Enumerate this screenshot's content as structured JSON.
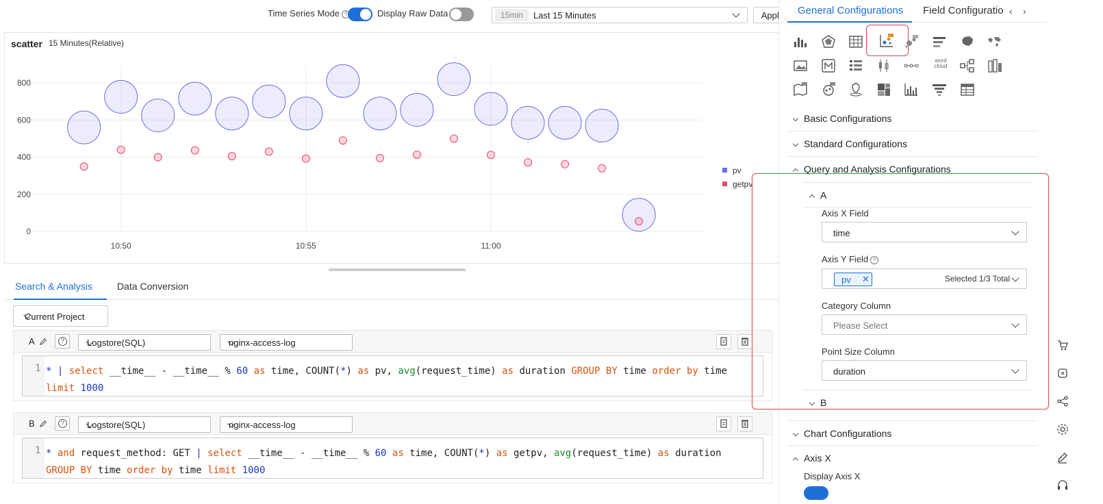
{
  "toolbar": {
    "time_series_mode_label": "Time Series Mode",
    "display_raw_data_label": "Display Raw Data",
    "time_range_tag": "15min",
    "time_range_value": "Last 15 Minutes",
    "apply_label": "Apply",
    "time_series_mode_on": true,
    "display_raw_data_on": false
  },
  "chart_panel": {
    "title": "scatter",
    "subtitle": "15 Minutes(Relative)"
  },
  "chart_data": {
    "type": "scatter",
    "title": "scatter",
    "x_tick_labels": [
      "10:50",
      "10:55",
      "11:00"
    ],
    "y_tick_labels": [
      "0",
      "200",
      "400",
      "600",
      "800"
    ],
    "ylim": [
      0,
      800
    ],
    "legend_position": "right",
    "grid": true,
    "series": [
      {
        "name": "pv",
        "color": "#6b6be8",
        "x": [
          "10:49",
          "10:50",
          "10:51",
          "10:52",
          "10:53",
          "10:54",
          "10:55",
          "10:56",
          "10:57",
          "10:58",
          "10:59",
          "11:00",
          "11:01",
          "11:02",
          "11:03",
          "11:04"
        ],
        "values": [
          560,
          725,
          625,
          715,
          635,
          700,
          635,
          810,
          635,
          655,
          820,
          660,
          585,
          585,
          570,
          90
        ]
      },
      {
        "name": "getpv",
        "color": "#e84a6e",
        "x": [
          "10:49",
          "10:50",
          "10:51",
          "10:52",
          "10:53",
          "10:54",
          "10:55",
          "10:56",
          "10:57",
          "10:58",
          "10:59",
          "11:00",
          "11:01",
          "11:02",
          "11:03",
          "11:04"
        ],
        "values": [
          350,
          440,
          400,
          437,
          405,
          430,
          392,
          490,
          395,
          413,
          500,
          412,
          372,
          362,
          340,
          55
        ]
      }
    ]
  },
  "bottom_tabs": [
    "Search & Analysis",
    "Data Conversion"
  ],
  "project_select": "Current Project",
  "queries": [
    {
      "letter": "A",
      "store_type": "Logstore(SQL)",
      "logstore": "nginx-access-log",
      "line_number": "1",
      "code": "* | select __time__ - __time__ % 60 as time, COUNT(*) as pv, avg(request_time) as duration GROUP BY time order by time limit 1000"
    },
    {
      "letter": "B",
      "store_type": "Logstore(SQL)",
      "logstore": "nginx-access-log",
      "line_number": "1",
      "code": "* and request_method: GET | select __time__ - __time__ % 60 as time, COUNT(*) as getpv, avg(request_time) as duration GROUP BY time order by time limit 1000"
    }
  ],
  "right_panel": {
    "tabs": [
      "General Configurations",
      "Field Configuratio"
    ],
    "sections": {
      "basic": "Basic Configurations",
      "standard": "Standard Configurations",
      "query": "Query and Analysis Configurations",
      "query_a": "A",
      "query_b": "B",
      "chart": "Chart Configurations",
      "axis_x": "Axis X",
      "display_axis_x": "Display Axis X"
    },
    "fields": {
      "axis_x_label": "Axis X Field",
      "axis_x_value": "time",
      "axis_y_label": "Axis Y Field",
      "axis_y_tag": "pv",
      "axis_y_count": "Selected 1/3 Total",
      "category_label": "Category Column",
      "category_placeholder": "Please Select",
      "point_size_label": "Point Size Column",
      "point_size_value": "duration"
    },
    "chart_type_icons": [
      "bar-chart-icon",
      "radar-chart-icon",
      "table-chart-icon",
      "scatter-chart-icon",
      "bubble-chart-icon",
      "progress-bar-icon",
      "china-map-icon",
      "world-map-icon",
      "image-icon",
      "markdown-icon",
      "list-icon",
      "candlestick-icon",
      "flow-icon",
      "word-cloud-icon",
      "topology-icon",
      "column-chart-icon",
      "map-pro-icon",
      "scatter-pro-icon",
      "location-icon",
      "treemap-icon",
      "histogram-icon",
      "funnel-icon",
      "data-table-icon"
    ],
    "word_cloud_text": "word cloud",
    "display_axis_x_on": true
  },
  "colors": {
    "accent": "#1f6fd9",
    "highlight_frame": "#e3424a"
  }
}
